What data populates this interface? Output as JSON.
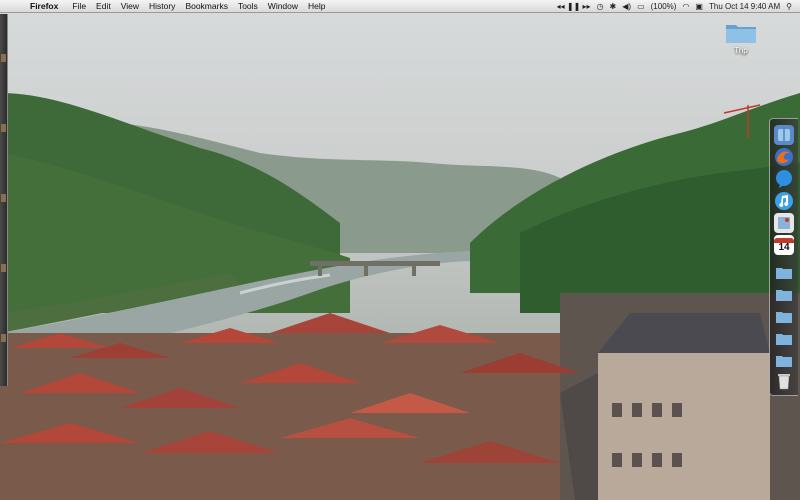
{
  "menubar": {
    "app_name": "Firefox",
    "menus": [
      "File",
      "Edit",
      "View",
      "History",
      "Bookmarks",
      "Tools",
      "Window",
      "Help"
    ],
    "battery": "(100%)",
    "clock": "Thu Oct 14  9:40 AM"
  },
  "desktop": {
    "folder_label": "Trip"
  },
  "dock": {
    "calendar_day": "14"
  },
  "icons": {
    "apple": "apple-logo-icon",
    "play_pause": "media-controls-icon",
    "timemachine": "time-machine-icon",
    "volume": "volume-icon",
    "battery": "battery-icon",
    "wifi": "wifi-icon",
    "spotlight": "spotlight-search-icon"
  },
  "colors": {
    "folder_blue": "#7fb2dc",
    "firefox_orange": "#e8701c",
    "roof_red": "#b2473a"
  }
}
